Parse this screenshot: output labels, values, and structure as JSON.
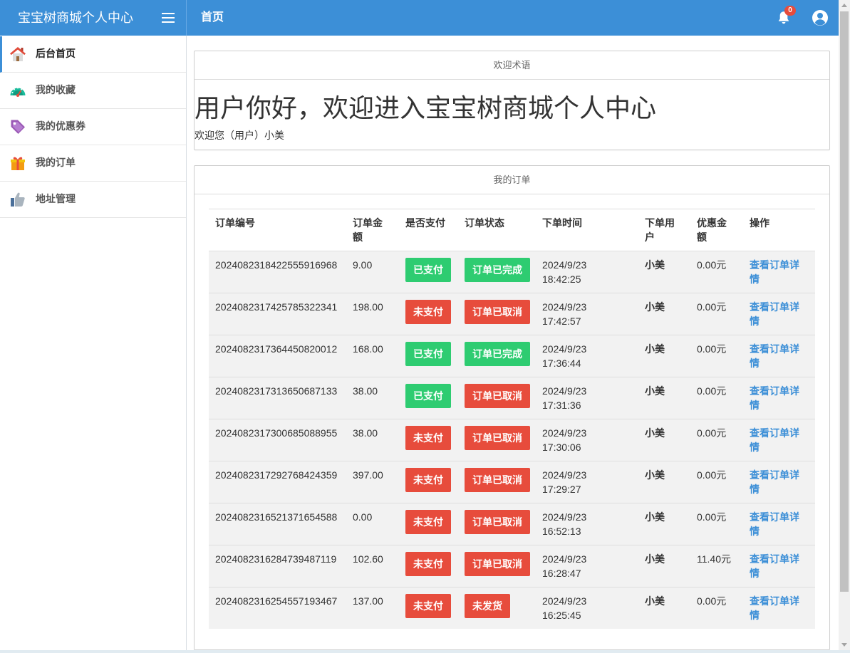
{
  "header": {
    "app_title": "宝宝树商城个人中心",
    "page_title": "首页",
    "notification_count": "0",
    "menu_icon": "menu-icon",
    "notifications_icon": "bell-icon",
    "user_icon": "user-circle-icon"
  },
  "sidebar": {
    "items": [
      {
        "label": "后台首页",
        "icon": "home-icon",
        "active": true
      },
      {
        "label": "我的收藏",
        "icon": "dashboard-gauge-icon"
      },
      {
        "label": "我的优惠券",
        "icon": "tag-icon"
      },
      {
        "label": "我的订单",
        "icon": "gift-icon"
      },
      {
        "label": "地址管理",
        "icon": "thumbs-up-icon"
      }
    ]
  },
  "welcome_panel": {
    "title": "欢迎术语",
    "heading": "用户你好，欢迎进入宝宝树商城个人中心",
    "greeting": "欢迎您（用户）小美"
  },
  "orders_panel": {
    "title": "我的订单",
    "columns": [
      "订单编号",
      "订单金额",
      "是否支付",
      "订单状态",
      "下单时间",
      "下单用户",
      "优惠金额",
      "操作"
    ],
    "rows": [
      {
        "order_no": "2024082318422555916968",
        "amount": "9.00",
        "paid": "已支付",
        "status": "订单已完成",
        "time": "2024/9/23 18:42:25",
        "user": "小美",
        "discount": "0.00元",
        "action": "查看订单详情"
      },
      {
        "order_no": "2024082317425785322341",
        "amount": "198.00",
        "paid": "未支付",
        "status": "订单已取消",
        "time": "2024/9/23 17:42:57",
        "user": "小美",
        "discount": "0.00元",
        "action": "查看订单详情"
      },
      {
        "order_no": "2024082317364450820012",
        "amount": "168.00",
        "paid": "已支付",
        "status": "订单已完成",
        "time": "2024/9/23 17:36:44",
        "user": "小美",
        "discount": "0.00元",
        "action": "查看订单详情"
      },
      {
        "order_no": "2024082317313650687133",
        "amount": "38.00",
        "paid": "已支付",
        "status": "订单已取消",
        "time": "2024/9/23 17:31:36",
        "user": "小美",
        "discount": "0.00元",
        "action": "查看订单详情"
      },
      {
        "order_no": "2024082317300685088955",
        "amount": "38.00",
        "paid": "未支付",
        "status": "订单已取消",
        "time": "2024/9/23 17:30:06",
        "user": "小美",
        "discount": "0.00元",
        "action": "查看订单详情"
      },
      {
        "order_no": "2024082317292768424359",
        "amount": "397.00",
        "paid": "未支付",
        "status": "订单已取消",
        "time": "2024/9/23 17:29:27",
        "user": "小美",
        "discount": "0.00元",
        "action": "查看订单详情"
      },
      {
        "order_no": "2024082316521371654588",
        "amount": "0.00",
        "paid": "未支付",
        "status": "订单已取消",
        "time": "2024/9/23 16:52:13",
        "user": "小美",
        "discount": "0.00元",
        "action": "查看订单详情"
      },
      {
        "order_no": "2024082316284739487119",
        "amount": "102.60",
        "paid": "未支付",
        "status": "订单已取消",
        "time": "2024/9/23 16:28:47",
        "user": "小美",
        "discount": "11.40元",
        "action": "查看订单详情"
      },
      {
        "order_no": "2024082316254557193467",
        "amount": "137.00",
        "paid": "未支付",
        "status": "未发货",
        "time": "2024/9/23 16:25:45",
        "user": "小美",
        "discount": "0.00元",
        "action": "查看订单详情"
      }
    ]
  },
  "colors": {
    "topbar": "#3c8fd7",
    "success": "#2ecc71",
    "danger": "#e74c3c",
    "link": "#3c8fd7",
    "row_background": "#f2f2f2"
  }
}
